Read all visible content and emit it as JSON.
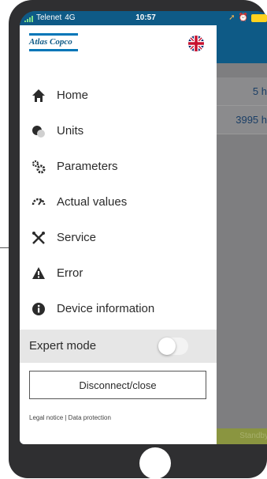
{
  "status_bar": {
    "carrier": "Telenet",
    "network": "4G",
    "time": "10:57"
  },
  "brand": {
    "logo_text": "Atlas Copco",
    "accent_color": "#0076b8"
  },
  "language_flag_icon": "uk-flag-icon",
  "menu": {
    "items": [
      {
        "label": "Home",
        "icon": "home-icon"
      },
      {
        "label": "Units",
        "icon": "units-icon"
      },
      {
        "label": "Parameters",
        "icon": "parameters-icon"
      },
      {
        "label": "Actual values",
        "icon": "gauge-icon"
      },
      {
        "label": "Service",
        "icon": "service-tools-icon"
      },
      {
        "label": "Error",
        "icon": "warning-icon"
      },
      {
        "label": "Device information",
        "icon": "info-icon"
      }
    ]
  },
  "expert_mode": {
    "label": "Expert mode",
    "enabled": false
  },
  "disconnect_label": "Disconnect/close",
  "legal": "Legal notice | Data protection",
  "background_values": {
    "row1": "5 h",
    "row2": "3995 h",
    "status": "Standby"
  }
}
